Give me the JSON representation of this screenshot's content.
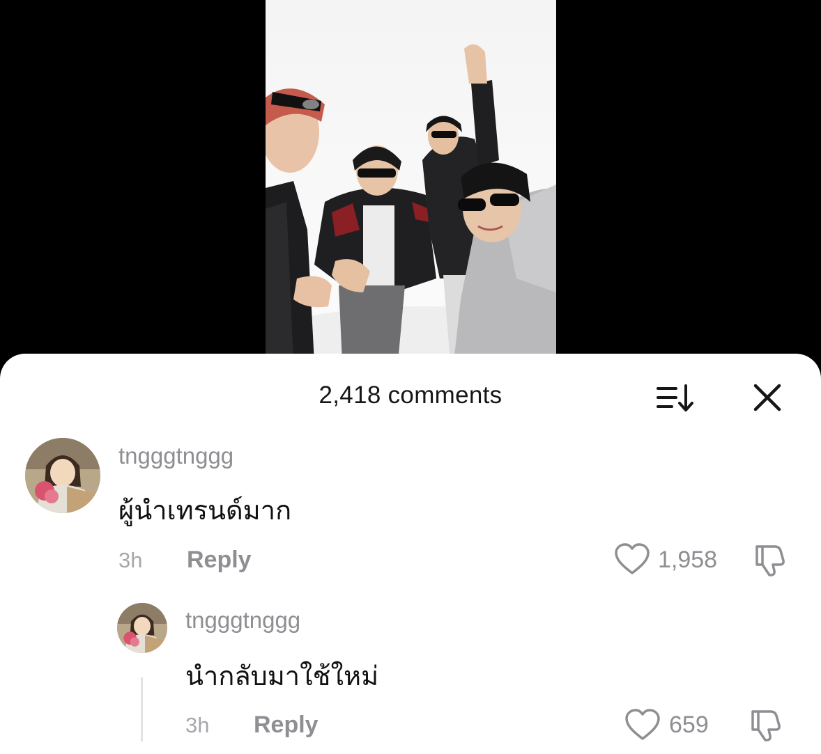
{
  "sheet": {
    "title": "2,418 comments",
    "sort_icon": "sort-icon",
    "close_icon": "close-icon"
  },
  "comments": [
    {
      "username": "tngggtnggg",
      "text": "ผู้นำเทรนด์มาก",
      "time": "3h",
      "reply_label": "Reply",
      "likes": "1,958"
    },
    {
      "username": "tngggtnggg",
      "text": "นำกลับมาใช้ใหม่",
      "time": "3h",
      "reply_label": "Reply",
      "likes": "659"
    }
  ],
  "colors": {
    "sheet_bg": "#ffffff",
    "muted_text": "#8e8e93",
    "primary_text": "#111111",
    "backdrop": "#000000"
  }
}
